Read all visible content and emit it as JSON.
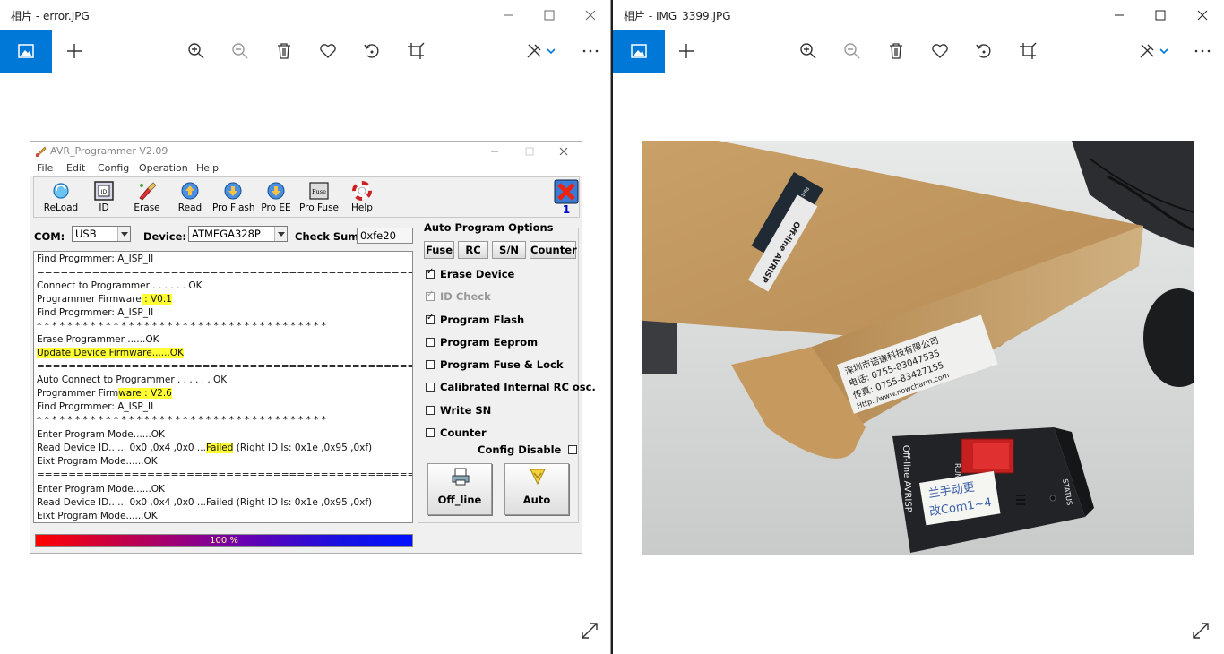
{
  "left_window": {
    "title": "相片 - error.JPG",
    "avr": {
      "title": "AVR_Programmer V2.09",
      "menu": [
        "File",
        "Edit",
        "Config",
        "Operation",
        "Help"
      ],
      "tools": [
        "ReLoad",
        "ID",
        "Erase",
        "Read",
        "Pro Flash",
        "Pro EE",
        "Pro Fuse",
        "Help"
      ],
      "error_counter": "1",
      "com_label": "COM:",
      "com_value": "USB",
      "device_label": "Device:",
      "device_value": "ATMEGA328P",
      "checksum_label": "Check Sum:",
      "checksum_value": "0xfe20",
      "log": {
        "l1": "Find Progrmmer: A_ISP_II",
        "l2": "================================================",
        "l3": "Connect to Programmer . . . . . . OK",
        "l4a": "Programmer Firmware",
        "l4b": " : V0.1",
        "l5": "Find Progrmmer: A_ISP_II",
        "l6": "* * * * * * * * * * * * * * * * * * * * * * * * * * * * * * * * * * * * * *",
        "l7": "Erase Programmer ......OK",
        "l8": "Update Device Firmware......OK",
        "l9": "================================================",
        "l10": "Auto Connect to Programmer . . . . . . OK",
        "l11a": "Programmer Firm",
        "l11b": "ware : V2.6",
        "l12": "Find Progrmmer: A_ISP_II",
        "l13": "* * * * * * * * * * * * * * * * * * * * * * * * * * * * * * * * * * * * * *",
        "l14": "Enter Program Mode......OK",
        "l15a": "Read Device ID...... 0x0 ,0x4 ,0x0 ...",
        "l15b": "Failed",
        "l15c": "  (Right ID Is: 0x1e ,0x95 ,0xf)",
        "l16": "Eixt Program Mode......OK",
        "l17": "================================================",
        "l18": "Enter Program Mode......OK",
        "l19": "Read Device ID...... 0x0 ,0x4 ,0x0 ...Failed  (Right ID Is: 0x1e ,0x95 ,0xf)",
        "l20": "Eixt Program Mode......OK"
      },
      "progress_text": "100 %",
      "progress_value": 1.0,
      "options": {
        "title": "Auto Program Options",
        "buttons": [
          "Fuse",
          "RC",
          "S/N",
          "Counter"
        ],
        "checks": [
          {
            "label": "Erase Device",
            "checked": true
          },
          {
            "label": "ID Check",
            "checked": true
          },
          {
            "label": "Program Flash",
            "checked": true
          },
          {
            "label": "Program Eeprom",
            "checked": false
          },
          {
            "label": "Program Fuse & Lock",
            "checked": false
          },
          {
            "label": "Calibrated Internal RC osc.",
            "checked": false
          },
          {
            "label": "Write SN",
            "checked": false
          },
          {
            "label": "Counter",
            "checked": false
          }
        ],
        "config_disable": "Config Disable",
        "offline_label": "Off_line",
        "auto_label": "Auto"
      }
    }
  },
  "right_window": {
    "title": "相片 - IMG_3399.JPG",
    "photo": {
      "label_top": "Part No",
      "label_model": "Off-line AVRISP",
      "company": "深圳市诺谦科技有限公司",
      "phone": "电话: 0755-83047535",
      "fax": "传真: 0755-83427155",
      "web": "Http://www.nowcharm.com",
      "device_name": "Off-line AVRISP",
      "run": "RUN",
      "status": "STATUS",
      "note1": "兰手动更",
      "note2": "改Com1~4"
    }
  },
  "colors": {
    "accent": "#0078d7",
    "highlight": "#ffff33"
  }
}
